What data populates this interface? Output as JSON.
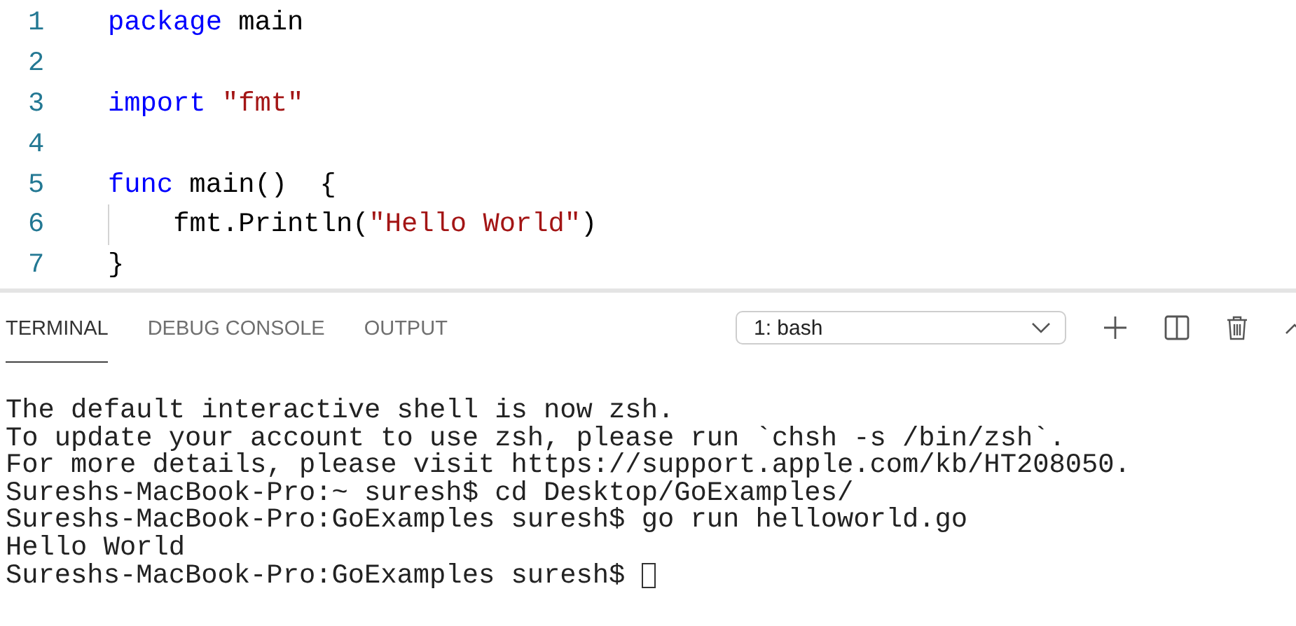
{
  "editor": {
    "lines": [
      {
        "number": "1",
        "tokens": [
          {
            "kind": "keyword",
            "text": "package"
          },
          {
            "kind": "plain",
            "text": " main"
          }
        ]
      },
      {
        "number": "2"
      },
      {
        "number": "3",
        "tokens": [
          {
            "kind": "keyword",
            "text": "import "
          },
          {
            "kind": "string",
            "text": "\"fmt\""
          }
        ]
      },
      {
        "number": "4"
      },
      {
        "number": "5",
        "tokens": [
          {
            "kind": "keyword",
            "text": "func"
          },
          {
            "kind": "plain",
            "text": " main()  {"
          }
        ]
      },
      {
        "number": "6",
        "indent_guide": true,
        "tokens": [
          {
            "kind": "plain",
            "text": "fmt.Println("
          },
          {
            "kind": "string",
            "text": "\"Hello World\""
          },
          {
            "kind": "plain",
            "text": ")"
          }
        ]
      },
      {
        "number": "7",
        "tokens": [
          {
            "kind": "plain",
            "text": "}"
          }
        ]
      }
    ]
  },
  "panel": {
    "tabs": [
      {
        "label": "TERMINAL",
        "selected": true
      },
      {
        "label": "DEBUG CONSOLE",
        "selected": false
      },
      {
        "label": "OUTPUT",
        "selected": false
      }
    ],
    "terminal_select": {
      "value": "1: bash"
    },
    "terminal": {
      "lines": [
        {
          "text": "The default interactive shell is now zsh."
        },
        {
          "text": "To update your account to use zsh, please run `chsh -s /bin/zsh`."
        },
        {
          "text": "For more details, please visit https://support.apple.com/kb/HT208050."
        },
        {
          "text": "Sureshs-MacBook-Pro:~ suresh$ cd Desktop/GoExamples/"
        },
        {
          "text": "Sureshs-MacBook-Pro:GoExamples suresh$ go run helloworld.go"
        },
        {
          "text": "Hello World"
        },
        {
          "text": "Sureshs-MacBook-Pro:GoExamples suresh$ ",
          "cursor": true
        }
      ]
    }
  }
}
